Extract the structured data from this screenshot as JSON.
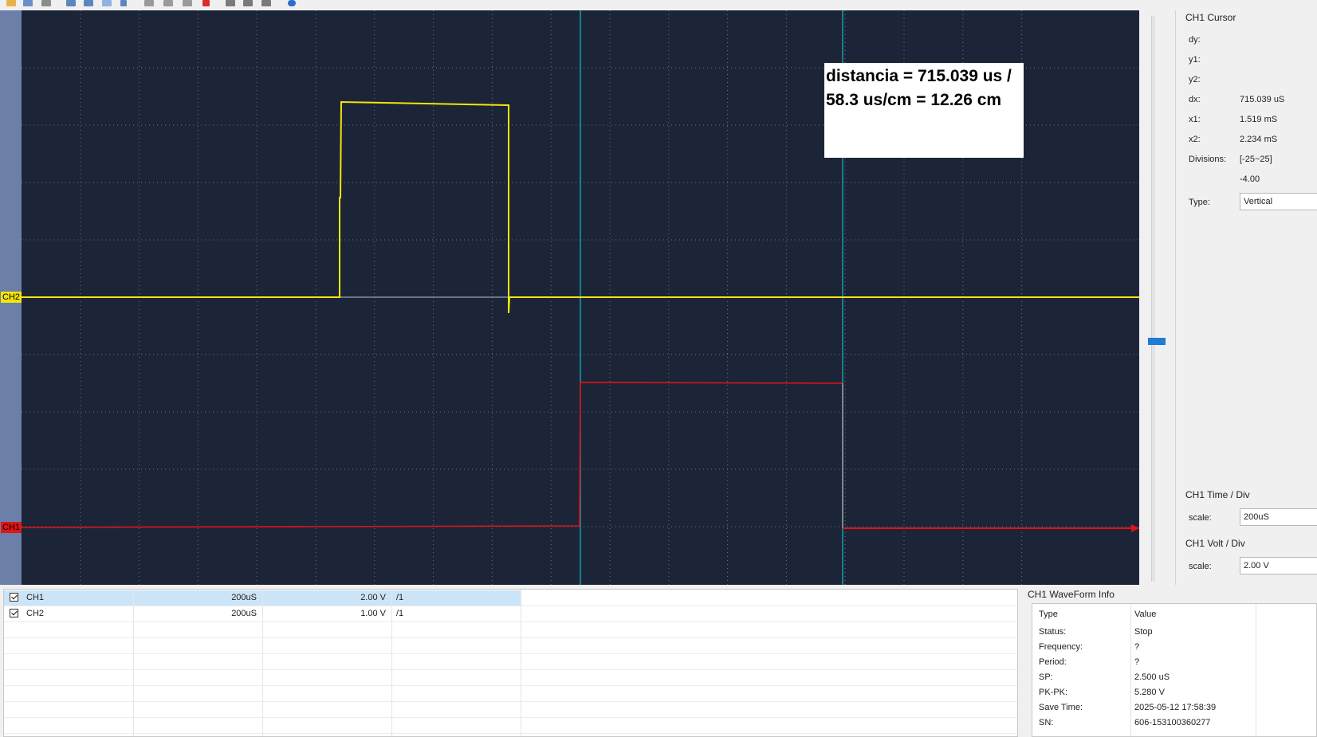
{
  "colors": {
    "scope_background": "#1c2537",
    "ch1": "#e01515",
    "ch2": "#f5e50a",
    "cursor": "#17b8c8",
    "grid": "#8a93a6"
  },
  "toolbar": {
    "icons": [
      "open-icon",
      "save-icon",
      "print-icon",
      "table-icon",
      "grid-icon",
      "measure-icon",
      "cursor-icon",
      "settings-icon",
      "copy-icon",
      "export-icon",
      "stop-icon",
      "play-icon",
      "snapshot-icon",
      "camera-icon",
      "help-icon"
    ]
  },
  "scope": {
    "annotation_line1": "distancia = 715.039 us /",
    "annotation_line2": "58.3 us/cm = 12.26 cm",
    "ch2_marker": "CH2",
    "ch1_marker": "CH1"
  },
  "cursor_panel": {
    "title": "CH1 Cursor",
    "rows": [
      {
        "label": "dy:",
        "value": ""
      },
      {
        "label": "y1:",
        "value": ""
      },
      {
        "label": "y2:",
        "value": ""
      },
      {
        "label": "dx:",
        "value": "715.039 uS"
      },
      {
        "label": "x1:",
        "value": "1.519 mS"
      },
      {
        "label": "x2:",
        "value": "2.234 mS"
      },
      {
        "label": "Divisions:",
        "value": "[-25~25]"
      },
      {
        "label": "",
        "value": "-4.00"
      }
    ],
    "type_label": "Type:",
    "type_value": "Vertical"
  },
  "time_div": {
    "title": "CH1 Time / Div",
    "scale_label": "scale:",
    "scale_value": "200uS"
  },
  "volt_div": {
    "title": "CH1 Volt / Div",
    "scale_label": "scale:",
    "scale_value": "2.00 V"
  },
  "channels": [
    {
      "name": "CH1",
      "time": "200uS",
      "volt": "2.00 V",
      "probe": "/1",
      "checked": true
    },
    {
      "name": "CH2",
      "time": "200uS",
      "volt": "1.00 V",
      "probe": "/1",
      "checked": true
    }
  ],
  "waveform_info": {
    "title": "CH1 WaveForm Info",
    "header": {
      "type": "Type",
      "value": "Value"
    },
    "rows": [
      {
        "type": "Status:",
        "value": "Stop"
      },
      {
        "type": "Frequency:",
        "value": "?"
      },
      {
        "type": "Period:",
        "value": "?"
      },
      {
        "type": "SP:",
        "value": "2.500 uS"
      },
      {
        "type": "PK-PK:",
        "value": "5.280 V"
      },
      {
        "type": "Save Time:",
        "value": "2025-05-12 17:58:39"
      },
      {
        "type": "SN:",
        "value": "606-153100360277"
      }
    ]
  }
}
